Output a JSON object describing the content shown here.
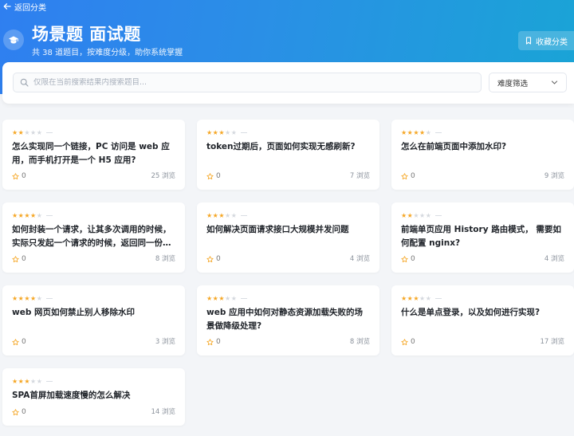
{
  "header": {
    "back_label": "返回分类",
    "title": "场景题 面试题",
    "subtitle": "共 38 道题目，按难度分级，助你系统掌握",
    "favorite_label": "收藏分类"
  },
  "search": {
    "placeholder": "仅限在当前搜索结果内搜索题目...",
    "value": "",
    "difficulty_label": "难度筛选"
  },
  "colors": {
    "hero_start": "#2f7ff0",
    "hero_end": "#1aa4d6",
    "star_on": "#f5a623",
    "star_off": "#d4d8de"
  },
  "icons": {
    "back": "arrow-left-icon",
    "category": "graduation-cap-icon",
    "favorite": "bookmark-icon",
    "search": "search-icon",
    "select": "chevron-down-icon",
    "like": "star-outline-icon"
  },
  "questions": [
    {
      "difficulty": 2,
      "title": "怎么实现同一个链接，PC 访问是 web 应用，而手机打开是一个 H5 应用?",
      "likes": "0",
      "views": "25 浏览"
    },
    {
      "difficulty": 3,
      "title": "token过期后，页面如何实现无感刷新?",
      "likes": "0",
      "views": "7 浏览"
    },
    {
      "difficulty": 4,
      "title": "怎么在前端页面中添加水印?",
      "likes": "0",
      "views": "9 浏览"
    },
    {
      "difficulty": 4,
      "title": "如何封装一个请求，让其多次调用的时候，实际只发起一个请求的时候，返回同一份结果",
      "likes": "0",
      "views": "8 浏览"
    },
    {
      "difficulty": 3,
      "title": "如何解决页面请求接口大规模并发问题",
      "likes": "0",
      "views": "4 浏览"
    },
    {
      "difficulty": 2,
      "title": "前端单页应用 History 路由模式， 需要如何配置 nginx?",
      "likes": "0",
      "views": "4 浏览"
    },
    {
      "difficulty": 4,
      "title": "web 网页如何禁止别人移除水印",
      "likes": "0",
      "views": "3 浏览"
    },
    {
      "difficulty": 3,
      "title": "web 应用中如何对静态资源加载失败的场景做降级处理?",
      "likes": "0",
      "views": "8 浏览"
    },
    {
      "difficulty": 3,
      "title": "什么是单点登录，以及如何进行实现?",
      "likes": "0",
      "views": "17 浏览"
    },
    {
      "difficulty": 3,
      "title": "SPA首屏加载速度慢的怎么解决",
      "likes": "0",
      "views": "14 浏览"
    }
  ]
}
